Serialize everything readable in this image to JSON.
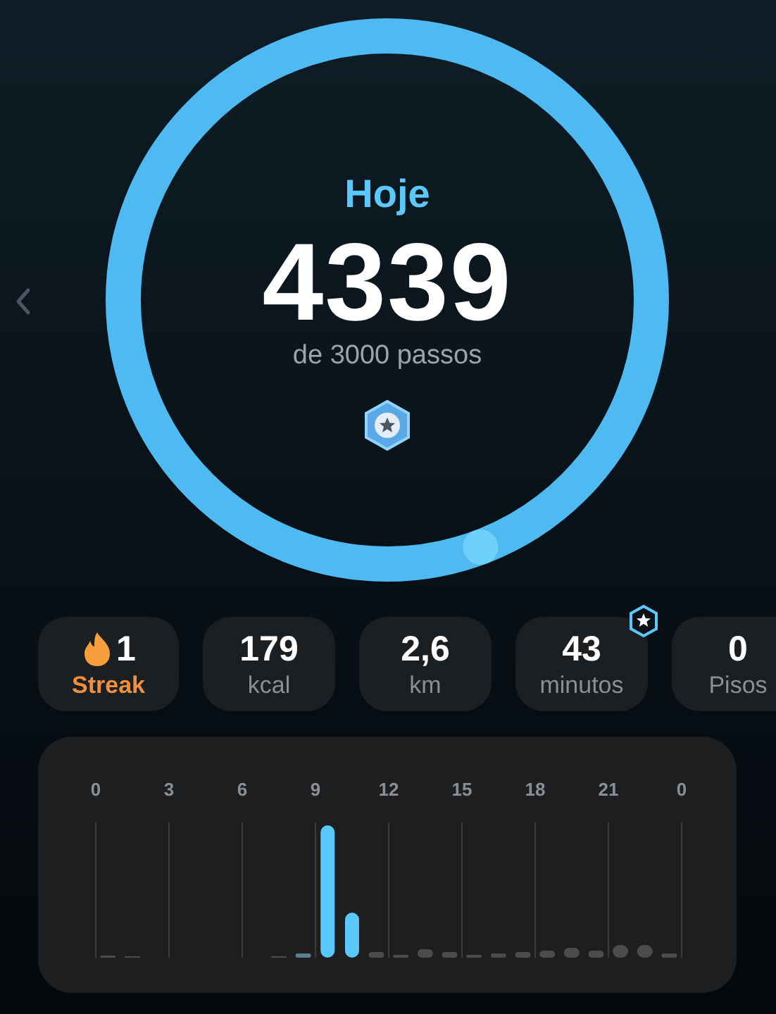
{
  "ring": {
    "title": "Hoje",
    "steps": "4339",
    "goal": "de 3000 passos"
  },
  "stats": [
    {
      "kind": "streak",
      "value": "1",
      "label": "Streak",
      "badge": false
    },
    {
      "kind": "stat",
      "value": "179",
      "label": "kcal",
      "badge": false
    },
    {
      "kind": "stat",
      "value": "2,6",
      "label": "km",
      "badge": false
    },
    {
      "kind": "stat",
      "value": "43",
      "label": "minutos",
      "badge": true
    },
    {
      "kind": "stat",
      "value": "0",
      "label": "Pisos",
      "badge": false
    }
  ],
  "hourly_chart": {
    "hour_labels": [
      "0",
      "3",
      "6",
      "9",
      "12",
      "15",
      "18",
      "21",
      "0"
    ]
  }
}
